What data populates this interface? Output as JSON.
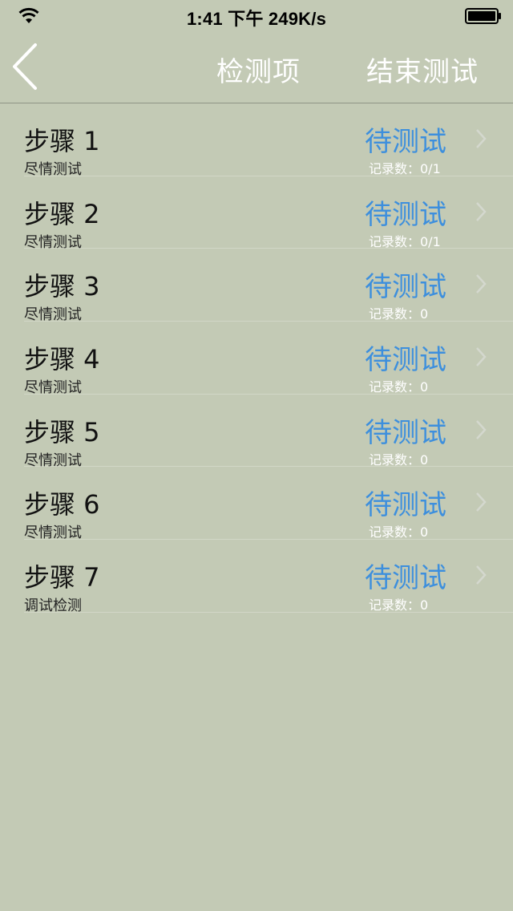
{
  "status_bar": {
    "time_and_speed": "1:41 下午 249K/s"
  },
  "nav": {
    "title": "检测项",
    "end_button_label": "结束测试"
  },
  "steps": [
    {
      "title": "步骤 1",
      "subtitle": "尽情测试",
      "status": "待测试",
      "record": "记录数：0/1"
    },
    {
      "title": "步骤 2",
      "subtitle": "尽情测试",
      "status": "待测试",
      "record": "记录数：0/1"
    },
    {
      "title": "步骤 3",
      "subtitle": "尽情测试",
      "status": "待测试",
      "record": "记录数：0"
    },
    {
      "title": "步骤 4",
      "subtitle": "尽情测试",
      "status": "待测试",
      "record": "记录数：0"
    },
    {
      "title": "步骤 5",
      "subtitle": "尽情测试",
      "status": "待测试",
      "record": "记录数：0"
    },
    {
      "title": "步骤 6",
      "subtitle": "尽情测试",
      "status": "待测试",
      "record": "记录数：0"
    },
    {
      "title": "步骤 7",
      "subtitle": "调试检测",
      "status": "待测试",
      "record": "记录数：0"
    }
  ],
  "colors": {
    "background": "#c3cab5",
    "status_accent": "#3d8fdd",
    "nav_text": "#ffffff"
  },
  "icons": {
    "back": "chevron-left-icon",
    "row_disclosure": "chevron-right-icon",
    "wifi": "wifi-icon",
    "battery": "battery-icon"
  }
}
